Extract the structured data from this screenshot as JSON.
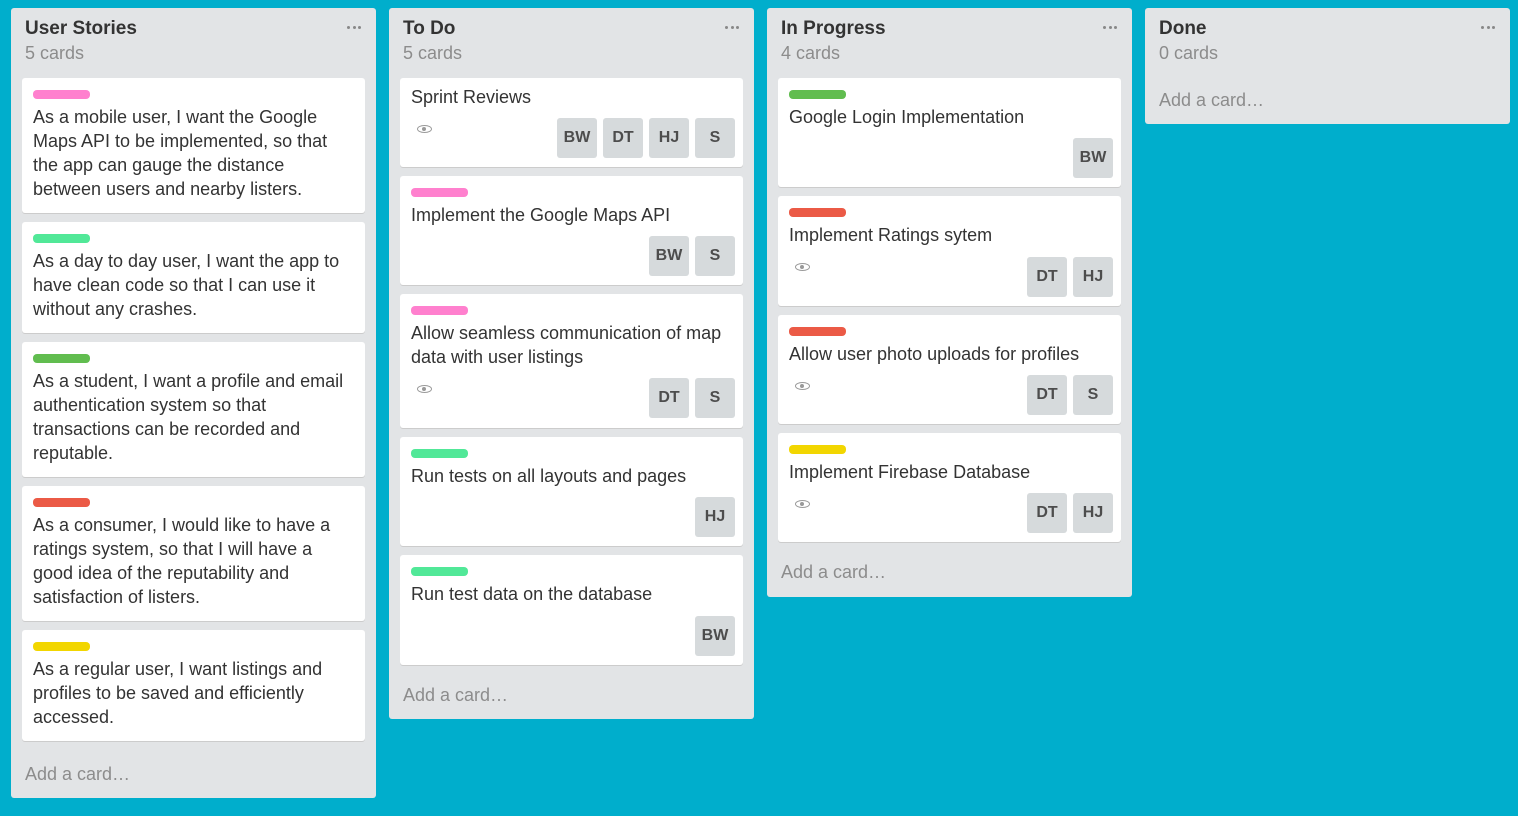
{
  "colors": {
    "background": "#00aecc",
    "pink": "#ff80ce",
    "mint": "#51e898",
    "green": "#61bd4f",
    "red": "#eb5a46",
    "yellow": "#f2d600"
  },
  "lists": [
    {
      "title": "User Stories",
      "count": "5 cards",
      "add_card": "Add a card…",
      "cards": [
        {
          "label_color": "pink",
          "text": "As a mobile user, I want the Google Maps API to be implemented, so that the app can gauge the distance between users and nearby listers."
        },
        {
          "label_color": "mint",
          "text": "As a day to day user, I want the app to have clean code so that I can use it without any crashes."
        },
        {
          "label_color": "green",
          "text": "As a student, I want a profile and email authentication system so that transactions can be recorded and reputable."
        },
        {
          "label_color": "red",
          "text": "As a consumer, I would like to have a ratings system, so that I will have a good idea of the reputability and satisfaction of listers."
        },
        {
          "label_color": "yellow",
          "text": "As a regular user, I want listings and profiles to be saved and efficiently accessed."
        }
      ]
    },
    {
      "title": "To Do",
      "count": "5 cards",
      "add_card": "Add a card…",
      "cards": [
        {
          "text": "Sprint Reviews",
          "watch_icon": "eye-icon",
          "members": [
            "BW",
            "DT",
            "HJ",
            "S"
          ]
        },
        {
          "label_color": "pink",
          "text": "Implement the Google Maps API",
          "members": [
            "BW",
            "S"
          ]
        },
        {
          "label_color": "pink",
          "text": "Allow seamless communication of map data with user listings",
          "watch_icon": "eye-icon",
          "members": [
            "DT",
            "S"
          ]
        },
        {
          "label_color": "mint",
          "text": "Run tests on all layouts and pages",
          "members": [
            "HJ"
          ]
        },
        {
          "label_color": "mint",
          "text": "Run test data on the database",
          "members": [
            "BW"
          ]
        }
      ]
    },
    {
      "title": "In Progress",
      "count": "4 cards",
      "add_card": "Add a card…",
      "cards": [
        {
          "label_color": "green",
          "text": "Google Login Implementation",
          "members": [
            "BW"
          ]
        },
        {
          "label_color": "red",
          "text": "Implement Ratings sytem",
          "watch_icon": "eye-icon",
          "members": [
            "DT",
            "HJ"
          ]
        },
        {
          "label_color": "red",
          "text": "Allow user photo uploads for profiles",
          "watch_icon": "eye-icon",
          "members": [
            "DT",
            "S"
          ]
        },
        {
          "label_color": "yellow",
          "text": "Implement Firebase Database",
          "watch_icon": "eye-icon",
          "members": [
            "DT",
            "HJ"
          ]
        }
      ]
    },
    {
      "title": "Done",
      "count": "0 cards",
      "add_card": "Add a card…",
      "cards": []
    }
  ]
}
